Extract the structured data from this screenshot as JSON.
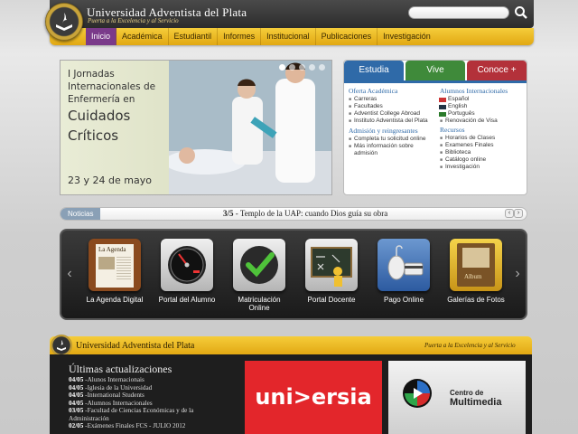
{
  "header": {
    "university_name": "Universidad Adventista del Plata",
    "slogan": "Puerta a la Excelencia y al Servicio",
    "search_placeholder": ""
  },
  "nav": {
    "items": [
      "Inicio",
      "Académica",
      "Estudiantil",
      "Informes",
      "Institucional",
      "Publicaciones",
      "Investigación"
    ],
    "active": "Inicio"
  },
  "banner": {
    "line1": "I Jornadas Internacionales de Enfermería en",
    "line2": "Cuidados",
    "line3": "Críticos",
    "date": "23 y 24 de mayo"
  },
  "tabs": {
    "labels": [
      "Estudia",
      "Vive",
      "Conoce +"
    ],
    "col1": {
      "heading1": "Oferta Académica",
      "items1": [
        "Carreras",
        "Facultades",
        "Adventist College Abroad",
        "Instituto Adventista del Plata"
      ],
      "heading2": "Admisión y reingresantes",
      "items2": [
        "Completa tu solicitud online",
        "Más información sobre admisión"
      ]
    },
    "col2": {
      "heading1": "Alumnos Internacionales",
      "items1": [
        "Español",
        "English",
        "Português",
        "Renovación de Visa"
      ],
      "heading2": "Recursos",
      "items2": [
        "Horarios de Clases",
        "Examenes Finales",
        "Biblioteca",
        "Catálogo online",
        "Investigación"
      ]
    }
  },
  "news": {
    "label": "Noticias",
    "counter": "3/5",
    "text": "Templo de la UAP: cuando Dios guía su obra"
  },
  "carousel": [
    {
      "label": "La Agenda Digital",
      "icon": "agenda-icon"
    },
    {
      "label": "Portal del Alumno",
      "icon": "gauge-icon"
    },
    {
      "label": "Matriculación Online",
      "icon": "checkmark-icon"
    },
    {
      "label": "Portal Docente",
      "icon": "blackboard-icon"
    },
    {
      "label": "Pago Online",
      "icon": "mouse-card-icon"
    },
    {
      "label": "Galerías de Fotos",
      "icon": "photo-album-icon"
    }
  ],
  "carousel_text": {
    "agenda": "La Agenda",
    "album": "Album"
  },
  "bottom": {
    "university_name": "Universidad Adventista del Plata",
    "slogan": "Puerta a la Excelencia y al Servicio",
    "updates_title": "Últimas actualizaciones",
    "updates": [
      {
        "date": "04/05",
        "text": "Alunos Internacionais"
      },
      {
        "date": "04/05",
        "text": "Iglesia de la Universidad"
      },
      {
        "date": "04/05",
        "text": "International Students"
      },
      {
        "date": "04/05",
        "text": "Alumnos Internacionales"
      },
      {
        "date": "03/05",
        "text": "Facultad de Ciencias Económicas y de la Administración"
      },
      {
        "date": "02/05",
        "text": "Exámenes Finales FCS - JULIO 2012"
      }
    ],
    "universia": "uni>ersia",
    "multimedia_line1": "Centro de",
    "multimedia_line2": "Multimedia"
  }
}
